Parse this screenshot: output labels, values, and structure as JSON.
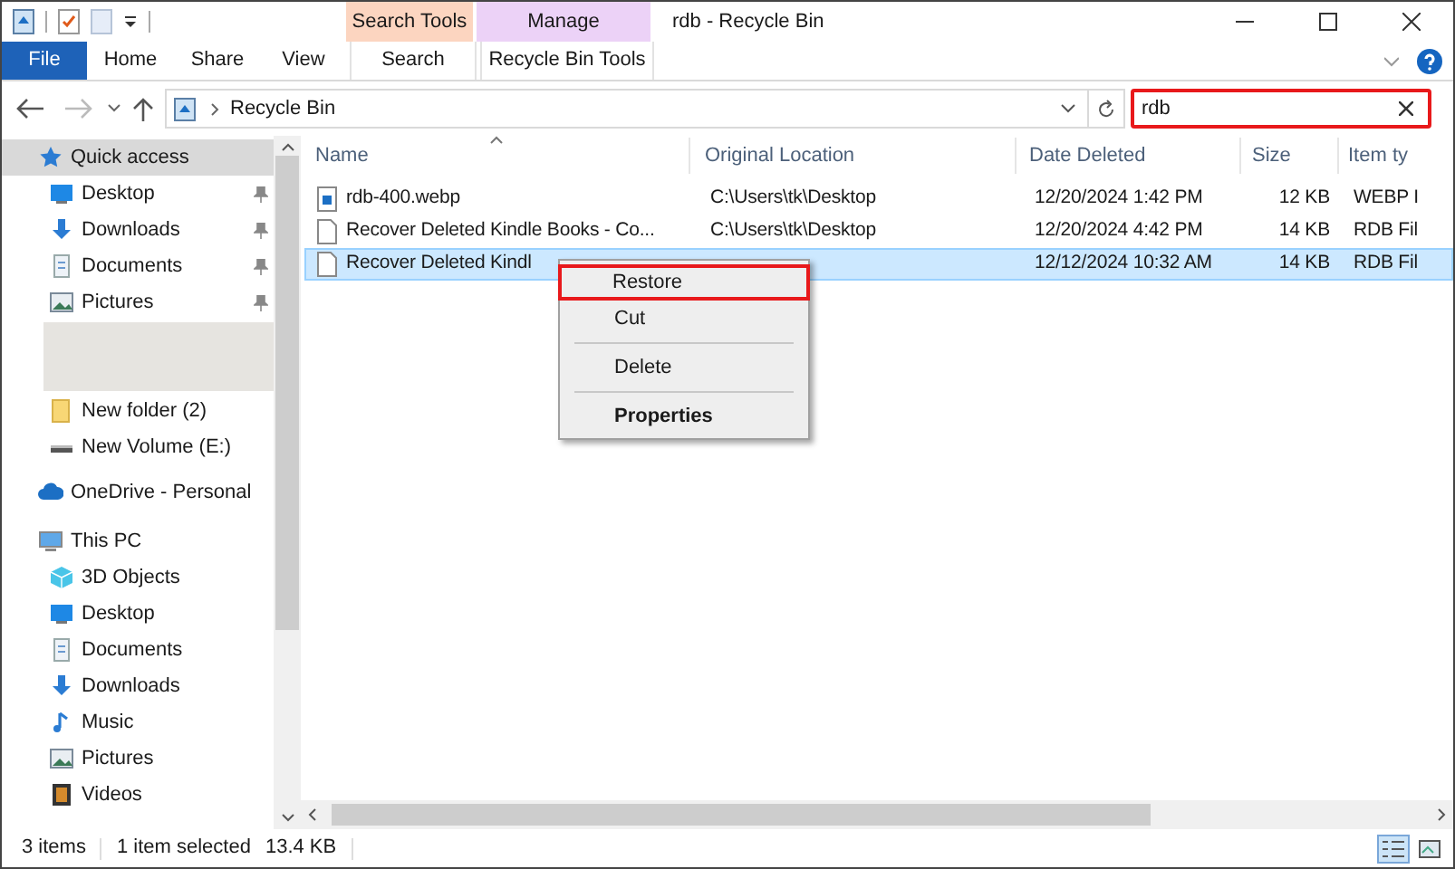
{
  "window": {
    "title": "rdb - Recycle Bin"
  },
  "context_tabs": [
    {
      "label": "Search Tools",
      "color": "#fcd5c0"
    },
    {
      "label": "Manage",
      "color": "#ecd2f7"
    }
  ],
  "ribbon_tabs": [
    {
      "label": "File",
      "selected": false,
      "kind": "file"
    },
    {
      "label": "Home",
      "selected": false,
      "kind": "tab"
    },
    {
      "label": "Share",
      "selected": false,
      "kind": "tab"
    },
    {
      "label": "View",
      "selected": false,
      "kind": "tab"
    },
    {
      "label": "Search",
      "selected": false,
      "kind": "context"
    },
    {
      "label": "Recycle Bin Tools",
      "selected": false,
      "kind": "context"
    }
  ],
  "address": {
    "path": "Recycle Bin"
  },
  "search": {
    "value": "rdb",
    "highlighted": true
  },
  "sidebar": {
    "items": [
      {
        "label": "Quick access",
        "kind": "section",
        "selected": true,
        "pinned": false
      },
      {
        "label": "Desktop",
        "kind": "item",
        "selected": false,
        "pinned": true
      },
      {
        "label": "Downloads",
        "kind": "item",
        "selected": false,
        "pinned": true
      },
      {
        "label": "Documents",
        "kind": "item",
        "selected": false,
        "pinned": true
      },
      {
        "label": "Pictures",
        "kind": "item",
        "selected": false,
        "pinned": true
      },
      {
        "kind": "blank"
      },
      {
        "label": "New folder (2)",
        "kind": "item",
        "selected": false,
        "pinned": false
      },
      {
        "label": "New Volume (E:)",
        "kind": "item",
        "selected": false,
        "pinned": false
      },
      {
        "label": "OneDrive - Personal",
        "kind": "section",
        "selected": false,
        "pinned": false
      },
      {
        "label": "This PC",
        "kind": "section",
        "selected": false,
        "pinned": false
      },
      {
        "label": "3D Objects",
        "kind": "item",
        "selected": false,
        "pinned": false
      },
      {
        "label": "Desktop",
        "kind": "item",
        "selected": false,
        "pinned": false
      },
      {
        "label": "Documents",
        "kind": "item",
        "selected": false,
        "pinned": false
      },
      {
        "label": "Downloads",
        "kind": "item",
        "selected": false,
        "pinned": false
      },
      {
        "label": "Music",
        "kind": "item",
        "selected": false,
        "pinned": false
      },
      {
        "label": "Pictures",
        "kind": "item",
        "selected": false,
        "pinned": false
      },
      {
        "label": "Videos",
        "kind": "item",
        "selected": false,
        "pinned": false
      }
    ]
  },
  "table": {
    "columns": [
      "Name",
      "Original Location",
      "Date Deleted",
      "Size",
      "Item ty"
    ],
    "rows": [
      {
        "selected": false,
        "kind": "image",
        "cells": [
          "rdb-400.webp",
          "C:\\Users\\tk\\Desktop",
          "12/20/2024 1:42 PM",
          "12 KB",
          "WEBP I"
        ]
      },
      {
        "selected": false,
        "kind": "file",
        "cells": [
          "Recover Deleted Kindle Books - Co...",
          "C:\\Users\\tk\\Desktop",
          "12/20/2024 4:42 PM",
          "14 KB",
          "RDB Fil"
        ]
      },
      {
        "selected": true,
        "kind": "file",
        "cells": [
          "Recover Deleted Kindl",
          "",
          "12/12/2024 10:32 AM",
          "14 KB",
          "RDB Fil"
        ]
      }
    ]
  },
  "context_menu": {
    "items": [
      {
        "label": "Restore",
        "bold": false,
        "highlighted": true
      },
      {
        "label": "Cut",
        "bold": false,
        "highlighted": false
      },
      {
        "label": "Delete",
        "bold": false,
        "highlighted": false
      },
      {
        "label": "Properties",
        "bold": true,
        "highlighted": false
      }
    ]
  },
  "status_bar": {
    "count": "3 items",
    "selection": "1 item selected",
    "size": "13.4 KB"
  }
}
